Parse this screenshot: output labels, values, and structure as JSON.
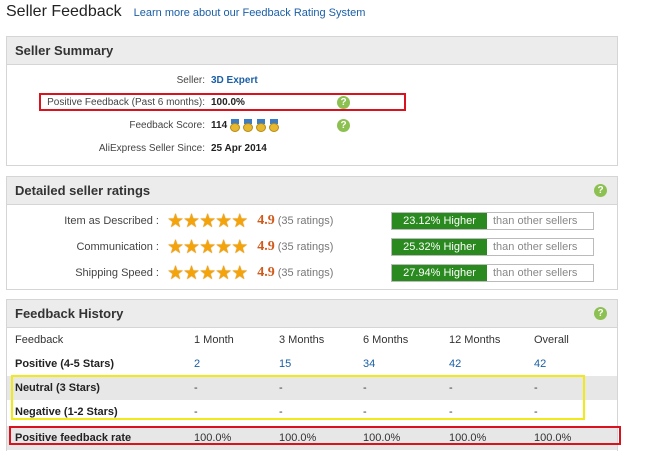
{
  "header": {
    "title": "Seller Feedback",
    "learn_link": "Learn more about our Feedback Rating System"
  },
  "summary": {
    "title": "Seller Summary",
    "seller_label": "Seller:",
    "seller_value": "3D Expert",
    "positive_label": "Positive Feedback (Past 6 months):",
    "positive_value": "100.0%",
    "score_label": "Feedback Score:",
    "score_value": "114",
    "since_label": "AliExpress Seller Since:",
    "since_value": "25 Apr 2014"
  },
  "ratings": {
    "title": "Detailed seller ratings",
    "rows": [
      {
        "label": "Item as Described :",
        "score": "4.9",
        "count": "(35 ratings)",
        "pct": "23.12% Higher",
        "compare": "than other sellers",
        "stars": 5
      },
      {
        "label": "Communication :",
        "score": "4.9",
        "count": "(35 ratings)",
        "pct": "25.32% Higher",
        "compare": "than other sellers",
        "stars": 5
      },
      {
        "label": "Shipping Speed :",
        "score": "4.9",
        "count": "(35 ratings)",
        "pct": "27.94% Higher",
        "compare": "than other sellers",
        "stars": 5
      }
    ]
  },
  "history": {
    "title": "Feedback History",
    "columns": [
      "Feedback",
      "1 Month",
      "3 Months",
      "6 Months",
      "12 Months",
      "Overall"
    ],
    "rows": [
      {
        "label": "Positive (4-5 Stars)",
        "values": [
          "2",
          "15",
          "34",
          "42",
          "42"
        ]
      },
      {
        "label": "Neutral (3 Stars)",
        "values": [
          "-",
          "-",
          "-",
          "-",
          "-"
        ]
      },
      {
        "label": "Negative (1-2 Stars)",
        "values": [
          "-",
          "-",
          "-",
          "-",
          "-"
        ]
      },
      {
        "label": "Positive feedback rate",
        "values": [
          "100.0%",
          "100.0%",
          "100.0%",
          "100.0%",
          "100.0%"
        ]
      }
    ]
  },
  "colors": {
    "link": "#1a5fa6",
    "higher_badge": "#2a8a1f",
    "score": "#d05a1b",
    "highlight_red": "#d9121d",
    "highlight_yellow": "#f2ea18"
  },
  "icons": {
    "help": "question-mark-icon",
    "star": "star-icon",
    "medal": "medal-icon"
  }
}
